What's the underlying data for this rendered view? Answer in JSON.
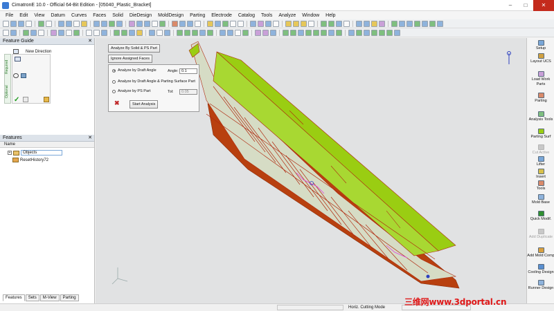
{
  "window": {
    "title": "CimatronE 10.0 - Official 64-Bit Edition - [05040_Plastic_Bracket]",
    "controls": [
      "minimize",
      "maximize",
      "close"
    ]
  },
  "menu": [
    "File",
    "Edit",
    "View",
    "Datum",
    "Curves",
    "Faces",
    "Solid",
    "DieDesign",
    "MoldDesign",
    "Parting",
    "Electrode",
    "Catalog",
    "Tools",
    "Analyze",
    "Window",
    "Help"
  ],
  "feature_guide": {
    "title": "Feature Guide",
    "step_label": "New Direction",
    "tab_required": "Required",
    "tab_optional": "Optional"
  },
  "features_panel": {
    "title": "Features",
    "column_name": "Name",
    "items": [
      "Objects",
      "ResetHistory72"
    ],
    "tabs": [
      "Features",
      "Sets",
      "M-View",
      "Parting"
    ]
  },
  "analysis_dialog": {
    "btn_analyze_solid": "Analyze By Solid & PS Part",
    "btn_ignore_faces": "Ignore Assigned Faces",
    "opt_draft_angle": "Analyze by Draft Angle",
    "opt_draft_parting": "Analyze by Draft Angle & Parting Surface Part",
    "opt_ps_part": "Analyze by PS Part",
    "angle_label": "Angle:",
    "angle_value": "0.1",
    "tol_label": "Tol:",
    "tol_value": "0.05",
    "start_button": "Start Analysis",
    "selected_option": "opt_draft_angle"
  },
  "right_panel": [
    {
      "label": "Setup",
      "disabled": false
    },
    {
      "label": "Layout UCS",
      "disabled": false
    },
    {
      "label": "Load Work Parts",
      "disabled": false
    },
    {
      "label": "Parting",
      "disabled": false
    },
    {
      "label": "Analysis Tools",
      "disabled": false
    },
    {
      "label": "Parting Surf",
      "disabled": false
    },
    {
      "label": "Cut Active",
      "disabled": true
    },
    {
      "label": "Lifter",
      "disabled": false
    },
    {
      "label": "Insert",
      "disabled": false
    },
    {
      "label": "Tools",
      "disabled": false
    },
    {
      "label": "Mold Base",
      "disabled": false
    },
    {
      "label": "Quick Modif.",
      "disabled": false
    },
    {
      "label": "Add Duplicate",
      "disabled": true
    },
    {
      "label": "Add Mold Comp",
      "disabled": false
    },
    {
      "label": "Cooling Design",
      "disabled": false
    },
    {
      "label": "Runner Design",
      "disabled": false
    }
  ],
  "status": {
    "mode": "Horiz. Cutting Mode"
  },
  "watermark": "三维网www.3dportal.cn",
  "colors": {
    "model_top": "#9acd12",
    "model_side": "#b8400f",
    "edge": "#b02a10",
    "viewport_bg": "#e1e2e3",
    "watermark": "#e01818"
  }
}
